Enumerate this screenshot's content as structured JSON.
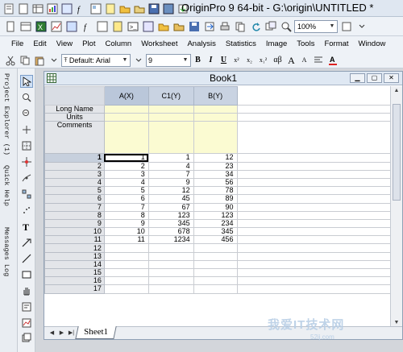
{
  "window": {
    "title": "OriginPro 9 64-bit - G:\\origin\\UNTITLED *"
  },
  "toolbar": {
    "zoom": "100%"
  },
  "menu": [
    "File",
    "Edit",
    "View",
    "Plot",
    "Column",
    "Worksheet",
    "Analysis",
    "Statistics",
    "Image",
    "Tools",
    "Format",
    "Window"
  ],
  "format_toolbar": {
    "font": "Default: Arial",
    "size": "9",
    "buttons": [
      "B",
      "I",
      "U",
      "x²",
      "x₂",
      "x₁²",
      "αβ",
      "A",
      "A"
    ]
  },
  "dock_tabs": [
    "Project Explorer (1)",
    "Quick Help",
    "Messages Log"
  ],
  "book": {
    "title": "Book1",
    "columns": [
      "A(X)",
      "C1(Y)",
      "B(Y)"
    ],
    "meta_rows": [
      "Long Name",
      "Units",
      "Comments"
    ],
    "rows": [
      [
        "1",
        "1",
        "1",
        "12"
      ],
      [
        "2",
        "2",
        "4",
        "23"
      ],
      [
        "3",
        "3",
        "7",
        "34"
      ],
      [
        "4",
        "4",
        "9",
        "56"
      ],
      [
        "5",
        "5",
        "12",
        "78"
      ],
      [
        "6",
        "6",
        "45",
        "89"
      ],
      [
        "7",
        "7",
        "67",
        "90"
      ],
      [
        "8",
        "8",
        "123",
        "123"
      ],
      [
        "9",
        "9",
        "345",
        "234"
      ],
      [
        "10",
        "10",
        "678",
        "345"
      ],
      [
        "11",
        "11",
        "1234",
        "456"
      ],
      [
        "12",
        "",
        "",
        ""
      ],
      [
        "13",
        "",
        "",
        ""
      ],
      [
        "14",
        "",
        "",
        ""
      ],
      [
        "15",
        "",
        "",
        ""
      ],
      [
        "16",
        "",
        "",
        ""
      ],
      [
        "17",
        "",
        "",
        ""
      ]
    ],
    "sheet_tab": "Sheet1"
  },
  "watermark": {
    "text": "我爱IT技术网",
    "url": "52ij.com"
  }
}
